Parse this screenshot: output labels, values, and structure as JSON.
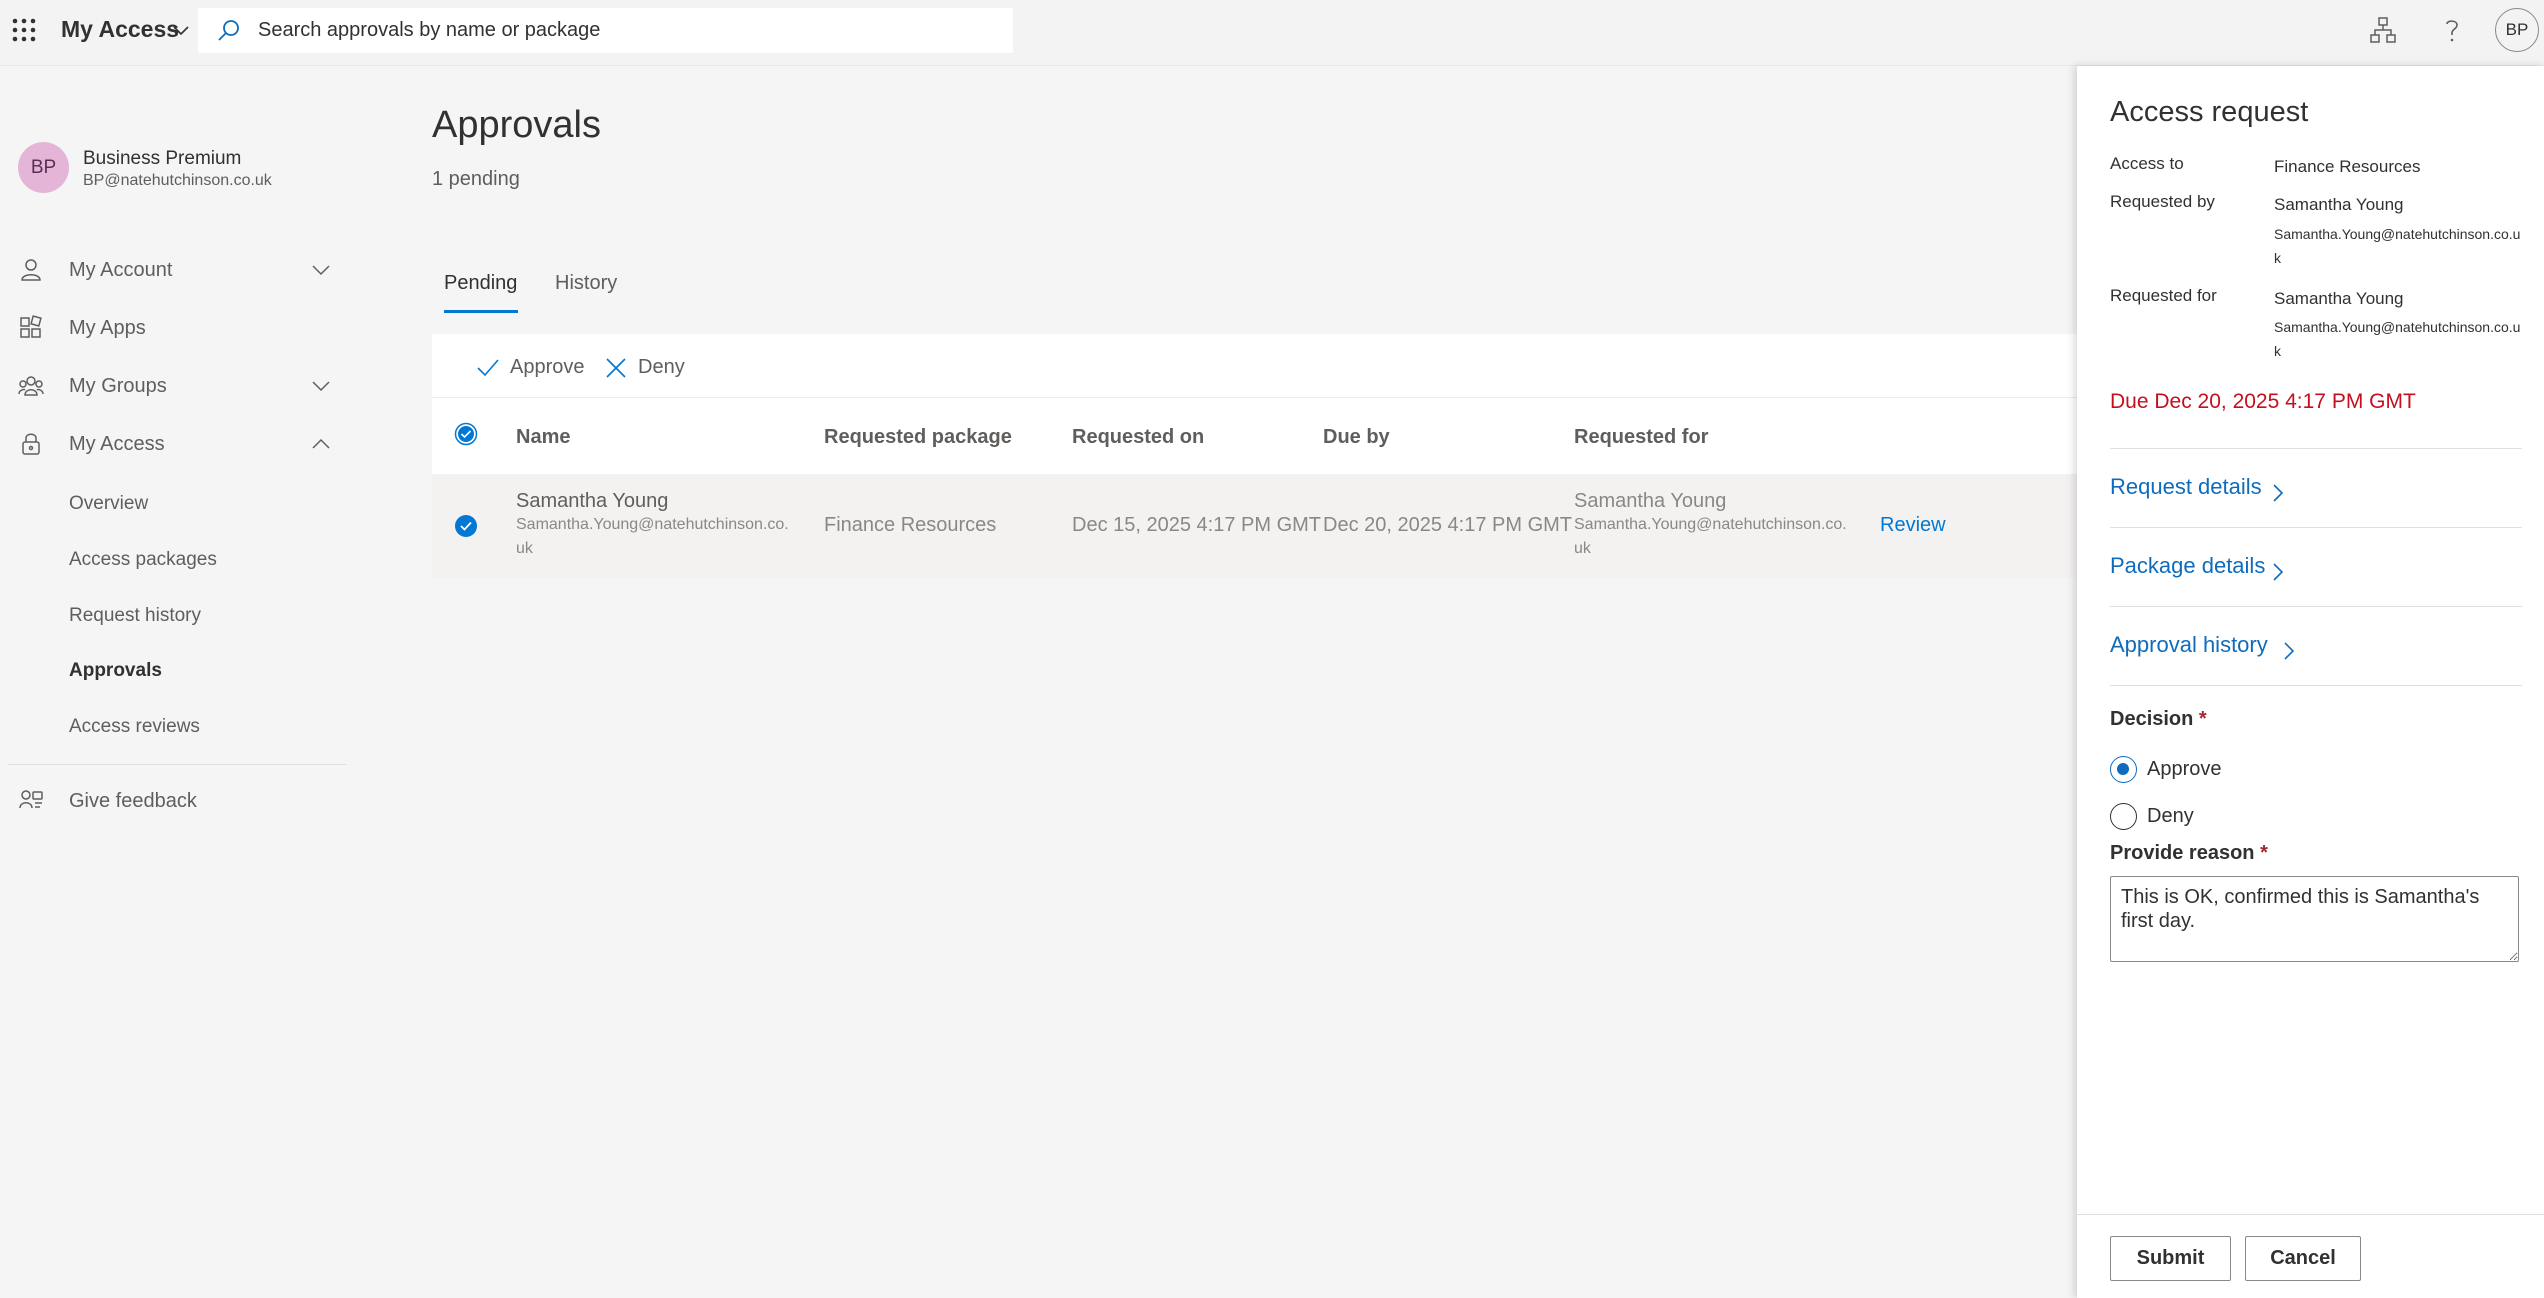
{
  "topbar": {
    "app_title": "My Access",
    "search_placeholder": "Search approvals by name or package",
    "avatar_initials": "BP"
  },
  "sidebar": {
    "user": {
      "initials": "BP",
      "name": "Business Premium",
      "email": "BP@natehutchinson.co.uk"
    },
    "items": [
      {
        "label": "My Account",
        "icon": "person-icon",
        "expandable": true
      },
      {
        "label": "My Apps",
        "icon": "apps-icon",
        "expandable": false
      },
      {
        "label": "My Groups",
        "icon": "groups-icon",
        "expandable": true
      },
      {
        "label": "My Access",
        "icon": "lock-icon",
        "expandable": true,
        "expanded": true
      }
    ],
    "sub_items": [
      "Overview",
      "Access packages",
      "Request history",
      "Approvals",
      "Access reviews"
    ],
    "active_sub_item": "Approvals",
    "feedback_label": "Give feedback"
  },
  "main": {
    "title": "Approvals",
    "pending_count": "1 pending",
    "tabs": [
      {
        "label": "Pending",
        "active": true
      },
      {
        "label": "History",
        "active": false
      }
    ],
    "toolbar": {
      "approve_label": "Approve",
      "deny_label": "Deny"
    },
    "columns": [
      "Name",
      "Requested package",
      "Requested on",
      "Due by",
      "Requested for"
    ],
    "rows": [
      {
        "name": "Samantha Young",
        "email_line1": "Samantha.Young@natehutchinson.co.",
        "email_line2": "uk",
        "package": "Finance Resources",
        "requested_on": "Dec 15, 2025 4:17 PM GMT",
        "due_by": "Dec 20, 2025 4:17 PM GMT",
        "requested_for_name": "Samantha Young",
        "requested_for_email_line1": "Samantha.Young@natehutchinson.co.",
        "requested_for_email_line2": "uk",
        "action": "Review",
        "selected": true
      }
    ]
  },
  "panel": {
    "title": "Access request",
    "access_to_label": "Access to",
    "access_to_value": "Finance Resources",
    "requested_by_label": "Requested by",
    "requested_by_name": "Samantha Young",
    "requested_by_email": "Samantha.Young@natehutchinson.co.uk",
    "requested_for_label": "Requested for",
    "requested_for_name": "Samantha Young",
    "requested_for_email": "Samantha.Young@natehutchinson.co.uk",
    "due": "Due Dec 20, 2025 4:17 PM GMT",
    "request_details": "Request details",
    "package_details": "Package details",
    "approval_history": "Approval history",
    "decision_label": "Decision",
    "required_mark": "*",
    "approve_option": "Approve",
    "deny_option": "Deny",
    "selected_decision": "Approve",
    "reason_label": "Provide reason",
    "reason_value": "This is OK, confirmed this is Samantha's first day.",
    "submit_label": "Submit",
    "cancel_label": "Cancel"
  },
  "colors": {
    "accent": "#0078d4",
    "link": "#0f6cbd",
    "due_red": "#c50f1f",
    "avatar_pink": "#e4b5d6"
  }
}
